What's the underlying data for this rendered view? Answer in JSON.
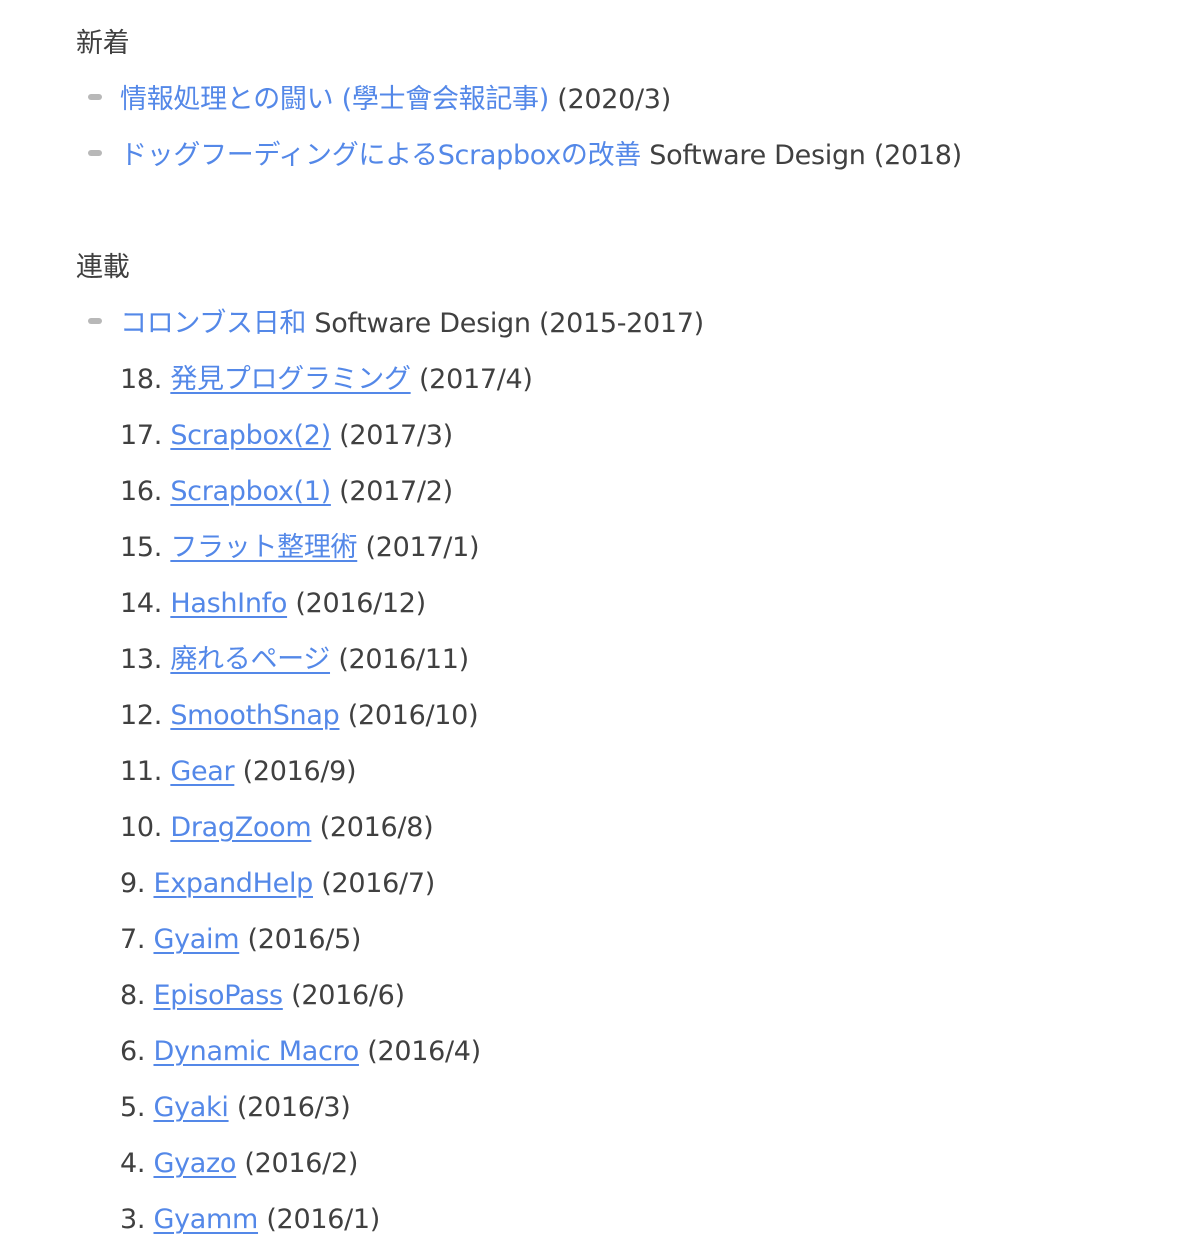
{
  "sections": {
    "new": {
      "heading": "新着",
      "items": [
        {
          "link": "情報処理との闘い (學士會会報記事)",
          "suffix": " (2020/3)"
        },
        {
          "link": "ドッグフーディングによるScrapboxの改善",
          "suffix": " Software Design (2018)"
        }
      ]
    },
    "series": {
      "heading": "連載",
      "parent": {
        "link": "コロンブス日和",
        "suffix": " Software Design (2015-2017)"
      },
      "items": [
        {
          "num": "18.",
          "link": "発見プログラミング",
          "date": "(2017/4)"
        },
        {
          "num": "17.",
          "link": "Scrapbox(2)",
          "date": "(2017/3)"
        },
        {
          "num": "16.",
          "link": "Scrapbox(1)",
          "date": "(2017/2)"
        },
        {
          "num": "15.",
          "link": "フラット整理術",
          "date": "(2017/1)"
        },
        {
          "num": "14.",
          "link": "HashInfo",
          "date": "(2016/12)"
        },
        {
          "num": "13.",
          "link": "廃れるページ",
          "date": "(2016/11)"
        },
        {
          "num": "12.",
          "link": "SmoothSnap",
          "date": "(2016/10)"
        },
        {
          "num": "11.",
          "link": "Gear",
          "date": "(2016/9)"
        },
        {
          "num": "10.",
          "link": "DragZoom",
          "date": "(2016/8)"
        },
        {
          "num": "9.",
          "link": "ExpandHelp",
          "date": "(2016/7)"
        },
        {
          "num": "7.",
          "link": "Gyaim",
          "date": "(2016/5)"
        },
        {
          "num": "8.",
          "link": "EpisoPass",
          "date": "(2016/6)"
        },
        {
          "num": "6.",
          "link": "Dynamic Macro",
          "date": "(2016/4)"
        },
        {
          "num": "5.",
          "link": "Gyaki",
          "date": "(2016/3)"
        },
        {
          "num": "4.",
          "link": "Gyazo",
          "date": "(2016/2)"
        },
        {
          "num": "3.",
          "link": "Gyamm",
          "date": "(2016/1)"
        }
      ]
    }
  }
}
